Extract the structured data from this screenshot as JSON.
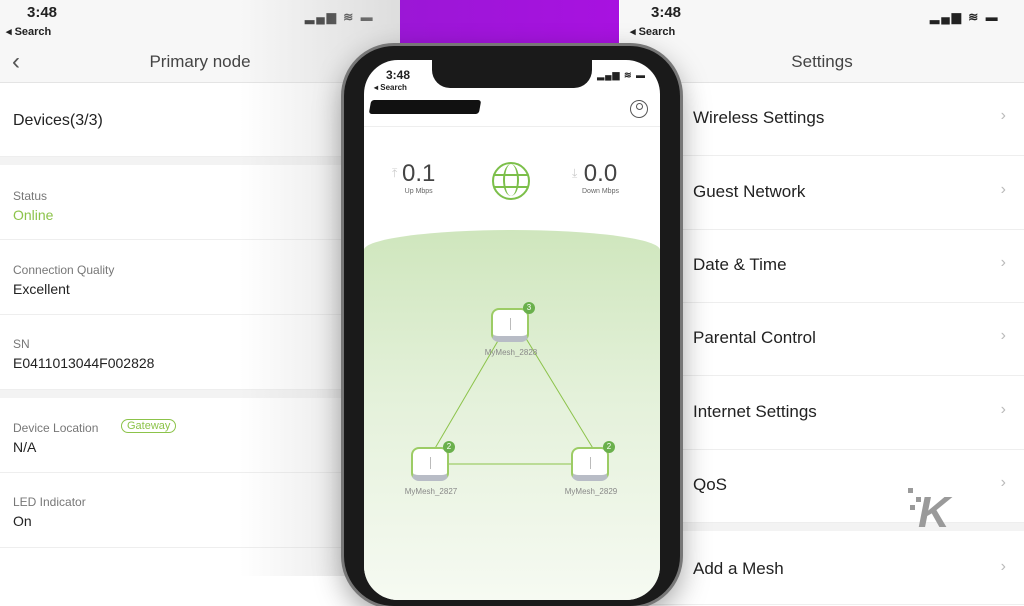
{
  "left_panel": {
    "status_bar": {
      "time": "3:48",
      "back_label": "◂ Search",
      "icons": "▂▄▆ ≋ ▬"
    },
    "nav": {
      "back_icon": "‹",
      "title": "Primary node"
    },
    "devices": "Devices(3/3)",
    "fields": [
      {
        "label": "Status",
        "value": "Online"
      },
      {
        "label": "Connection Quality",
        "value": "Excellent"
      },
      {
        "label": "SN",
        "value": "E0411013044F002828"
      },
      {
        "label": "Device Location",
        "value": "N/A",
        "badge": "Gateway"
      },
      {
        "label": "LED Indicator",
        "value": "On"
      }
    ]
  },
  "phone": {
    "status_bar": {
      "time": "3:48",
      "back_label": "◂ Search",
      "icons": "▂▄▆ ≋ ▬"
    },
    "upload": {
      "value": "0.1",
      "unit": "Up Mbps",
      "arrow": "⤒"
    },
    "download": {
      "value": "0.0",
      "unit": "Down Mbps",
      "arrow": "⤓"
    },
    "nodes": [
      {
        "name": "MyMesh_2828",
        "count": "3"
      },
      {
        "name": "MyMesh_2827",
        "count": "2"
      },
      {
        "name": "MyMesh_2829",
        "count": "2"
      }
    ]
  },
  "right_panel": {
    "status_bar": {
      "time": "3:48",
      "back_label": "◂ Search",
      "icons": "▂▄▆ ≋ ▬"
    },
    "nav": {
      "title": "Settings"
    },
    "items": [
      {
        "label": "Wireless Settings"
      },
      {
        "label": "Guest Network"
      },
      {
        "label": "Date & Time"
      },
      {
        "label": "Parental Control"
      },
      {
        "label": "Internet Settings"
      },
      {
        "label": "QoS"
      },
      {
        "label": "Add a Mesh"
      }
    ],
    "chevron": "›"
  },
  "watermark": "K",
  "colors": {
    "accent_green": "#8cc34a",
    "purple": "#a812e0"
  }
}
